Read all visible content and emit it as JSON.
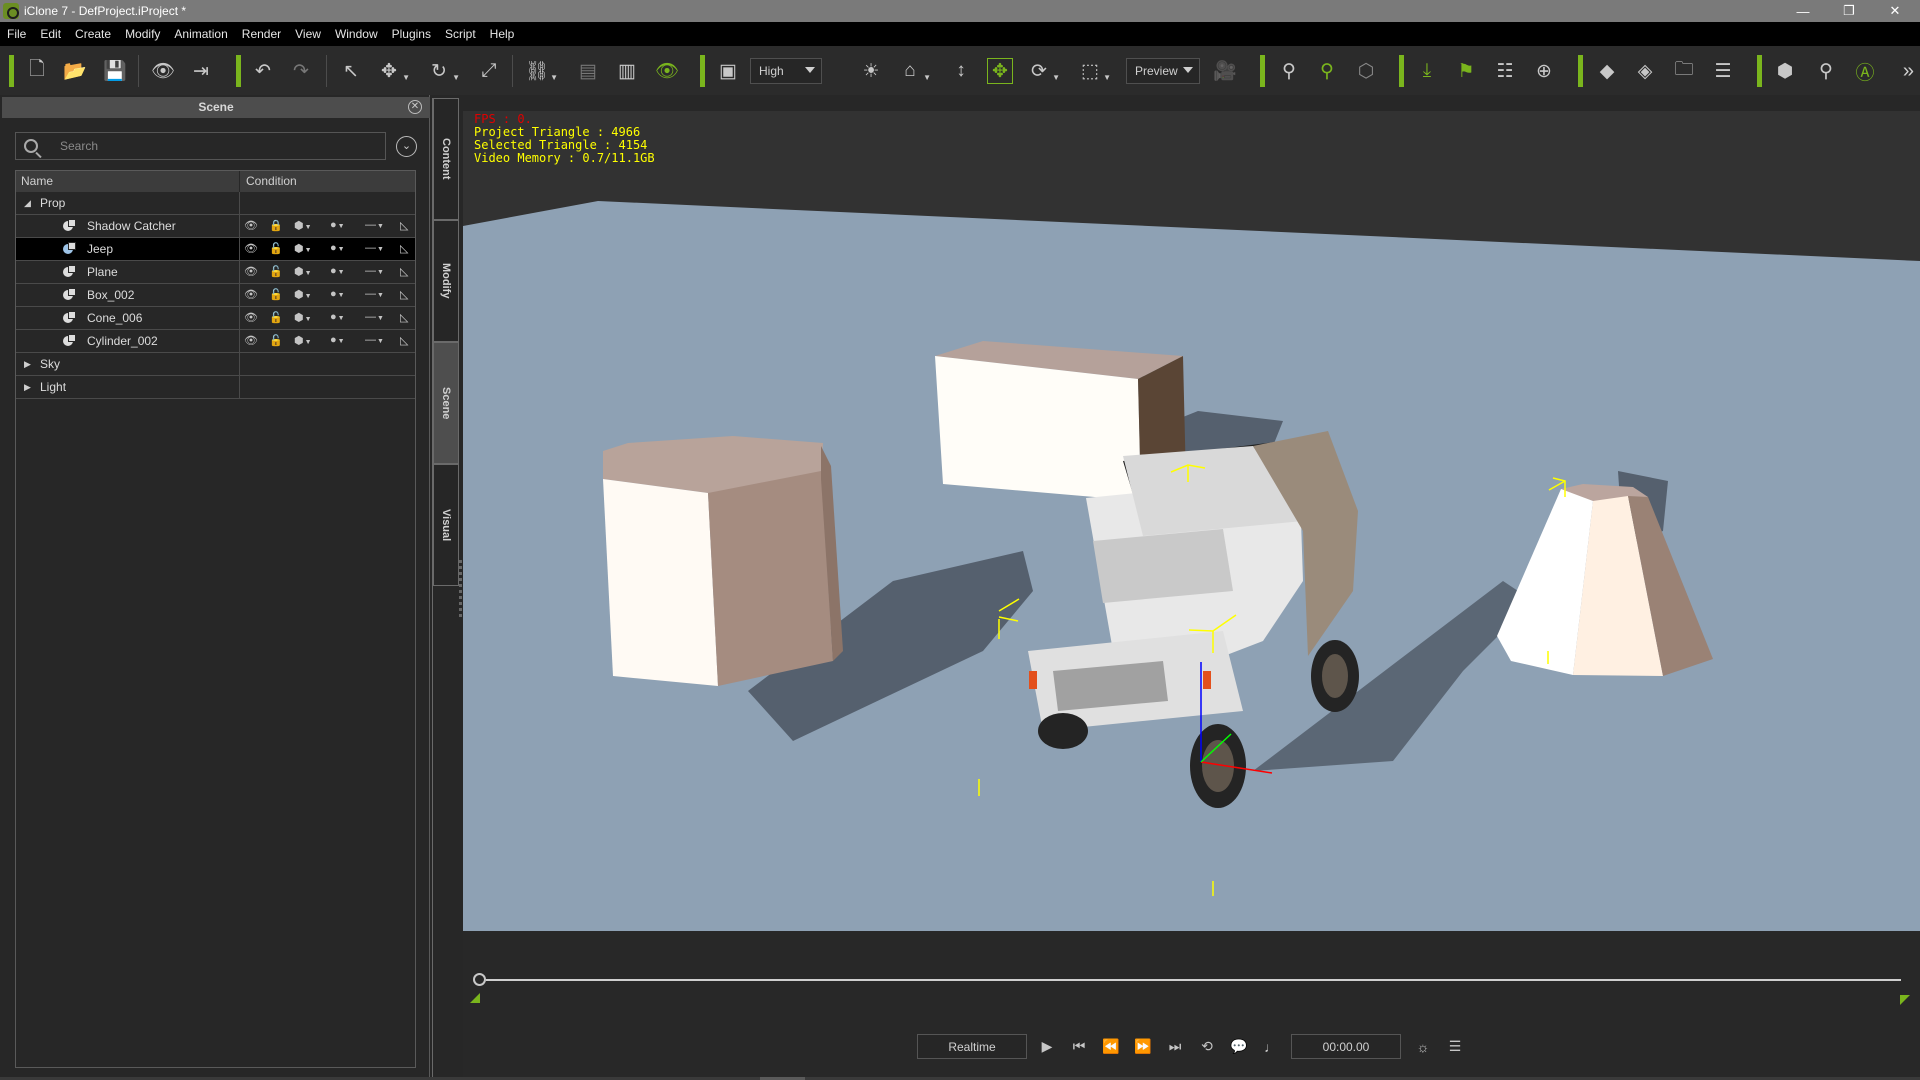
{
  "window": {
    "title": "iClone 7 - DefProject.iProject *",
    "controls": {
      "minimize": "—",
      "restore": "❐",
      "close": "✕"
    }
  },
  "menu": [
    "File",
    "Edit",
    "Create",
    "Modify",
    "Animation",
    "Render",
    "View",
    "Window",
    "Plugins",
    "Script",
    "Help"
  ],
  "toolbar": {
    "quality_select": "High",
    "render_mode_select": "Preview",
    "icons": {
      "new": "🗋",
      "open": "📂",
      "save": "💾",
      "preview": "👁",
      "export": "⇥",
      "undo": "↶",
      "redo": "↷",
      "select": "↖",
      "move": "✥",
      "rotate": "↻",
      "scale": "⤢",
      "link": "⛓",
      "align": "▤",
      "distribute": "▥",
      "visibility": "👁",
      "layout": "▣",
      "light": "☀",
      "home": "⌂",
      "fit": "↕",
      "pan": "✥",
      "orbit": "⟳",
      "frame": "⬚",
      "camera": "🎥",
      "gravity": "⚲",
      "effector": "⚲",
      "cluster": "⬡",
      "ik": "⤓",
      "flag": "⚑",
      "checklist": "☷",
      "pivot": "⊕",
      "key": "◆",
      "key-select": "◈",
      "key-folder": "🗀",
      "key-settings": "☰",
      "cube-view": "⬢",
      "motion-search": "⚲",
      "auto": "Ⓐ",
      "more": "»"
    }
  },
  "scene_panel": {
    "title": "Scene",
    "search_placeholder": "Search",
    "columns": [
      "Name",
      "Condition"
    ],
    "groups": [
      {
        "name": "Prop",
        "expanded": true,
        "items": [
          {
            "name": "Shadow Catcher",
            "selected": false,
            "locked": true
          },
          {
            "name": "Jeep",
            "selected": true,
            "locked": false
          },
          {
            "name": "Plane",
            "selected": false,
            "locked": false
          },
          {
            "name": "Box_002",
            "selected": false,
            "locked": false
          },
          {
            "name": "Cone_006",
            "selected": false,
            "locked": false
          },
          {
            "name": "Cylinder_002",
            "selected": false,
            "locked": false
          }
        ]
      },
      {
        "name": "Sky",
        "expanded": false,
        "items": []
      },
      {
        "name": "Light",
        "expanded": false,
        "items": []
      }
    ]
  },
  "side_tabs": [
    {
      "label": "Content",
      "active": false
    },
    {
      "label": "Modify",
      "active": false
    },
    {
      "label": "Scene",
      "active": true
    },
    {
      "label": "Visual",
      "active": false
    }
  ],
  "viewport": {
    "stats": {
      "fps": "FPS : 0.",
      "project_triangle": "Project Triangle : 4966",
      "selected_triangle": "Selected Triangle : 4154",
      "video_memory": "Video Memory : 0.7/11.1GB"
    },
    "objects": [
      "Cylinder_002",
      "Box_002",
      "Cone_006",
      "Jeep",
      "Plane"
    ],
    "colors": {
      "background": "#323232",
      "plane": "#8ea1b4",
      "shadow": "#55606e",
      "prop_light": "#fffaf4",
      "prop_mid": "#a58c80",
      "prop_dark": "#5a4535",
      "gizmo": "#ffff00"
    }
  },
  "timeline": {
    "playback_mode": "Realtime",
    "time": "00:00.00",
    "progress": 0
  },
  "accent_color": "#7ab51d"
}
